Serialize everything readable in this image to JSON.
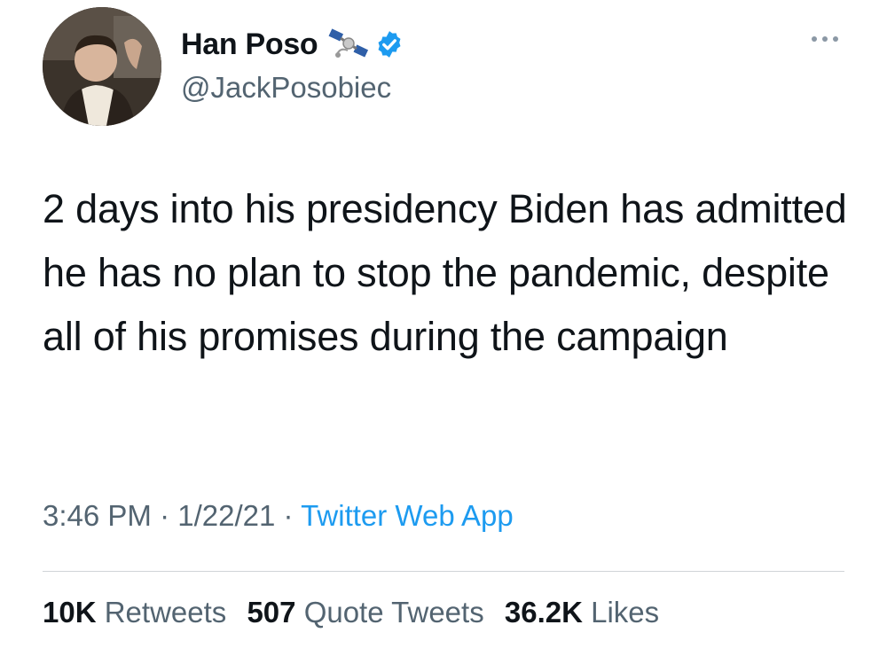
{
  "user": {
    "display_name": "Han Poso",
    "handle": "@JackPosobiec",
    "badge_icon": "satellite-icon",
    "verified_icon": "verified-badge-icon",
    "verified_color": "#1d9bf0"
  },
  "tweet": {
    "text": "2 days into his presidency Biden has admitted he has no plan to stop the pandemic, despite all of his promises during the campaign"
  },
  "meta": {
    "time": "3:46 PM",
    "sep1": " · ",
    "date": "1/22/21",
    "sep2": " · ",
    "source": "Twitter Web App"
  },
  "stats": {
    "retweets_count": "10K",
    "retweets_label": "Retweets",
    "quotes_count": "507",
    "quotes_label": "Quote Tweets",
    "likes_count": "36.2K",
    "likes_label": "Likes"
  },
  "colors": {
    "text": "#0f1419",
    "secondary": "#536471",
    "link": "#1d9bf0"
  }
}
